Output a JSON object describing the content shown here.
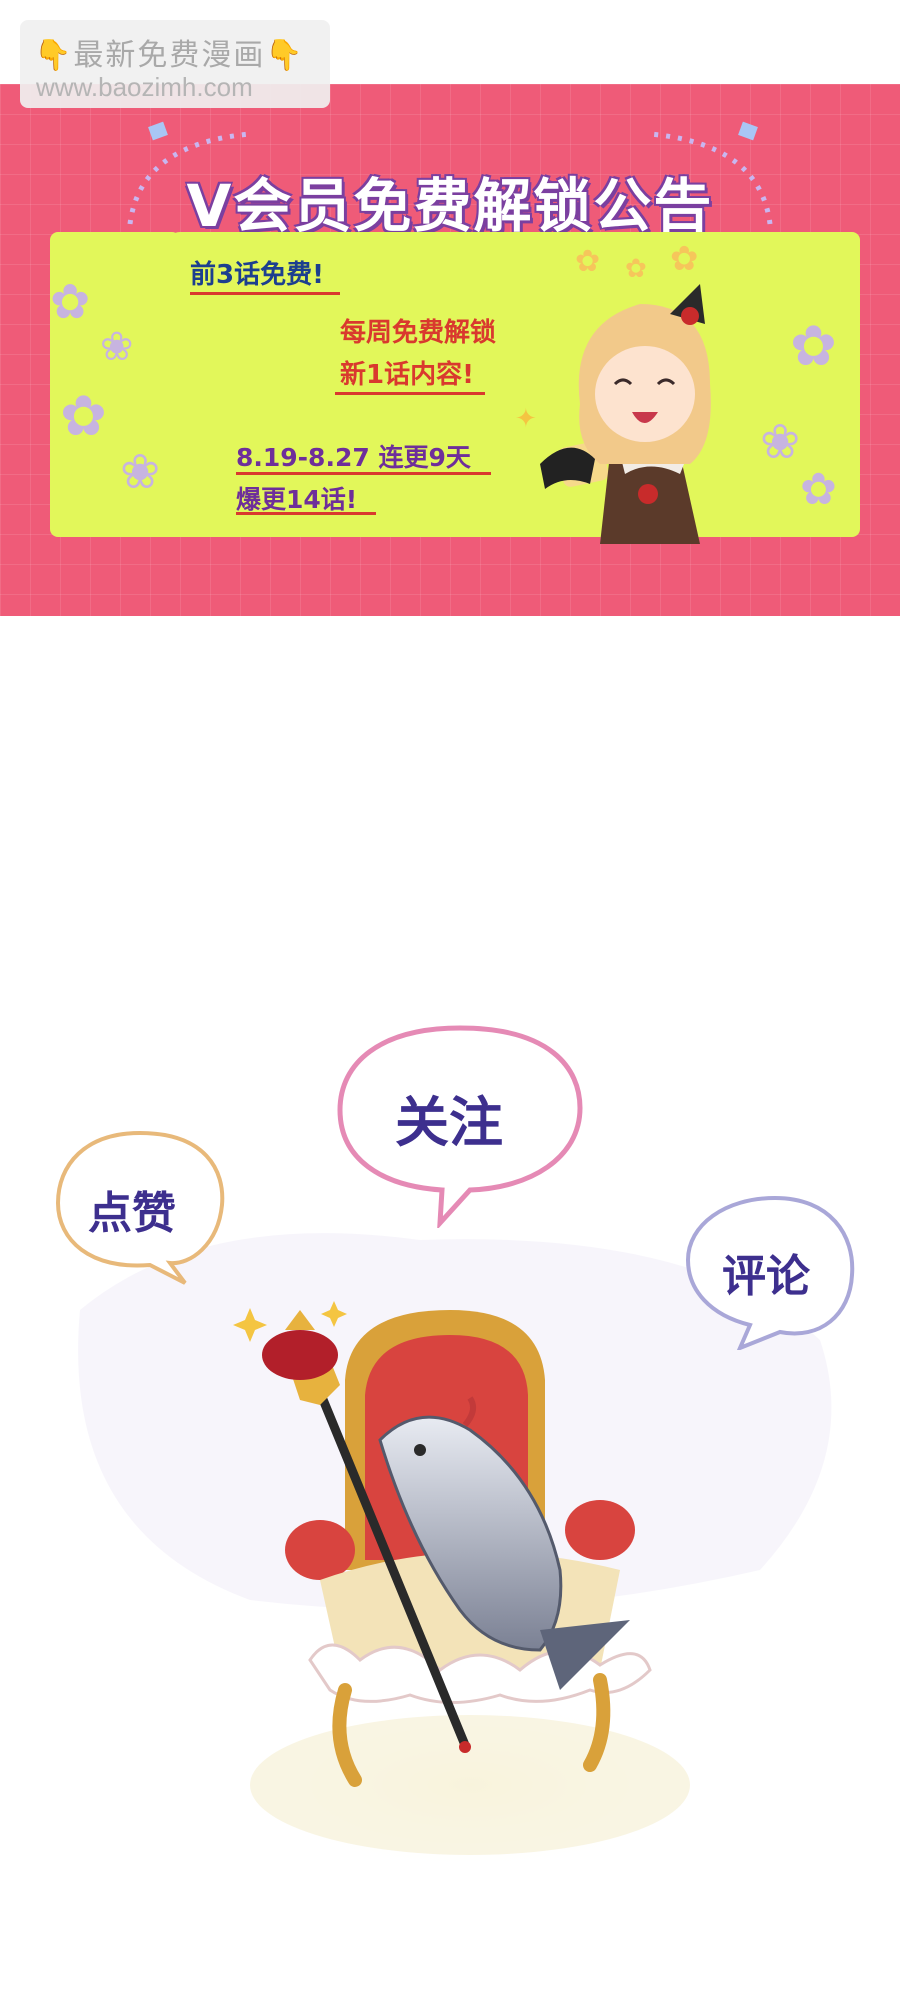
{
  "watermark": {
    "line1": "最新免费漫画",
    "line2": "www.baozimh.com",
    "hand_icon": "👇"
  },
  "banner": {
    "title": "V会员免费解锁公告",
    "free_first": "前3话免费!",
    "weekly_line1": "每周免费解锁",
    "weekly_line2": "新1话内容!",
    "dates": "8.19-8.27 连更9天",
    "burst": "爆更14话!"
  },
  "bubbles": {
    "like": "点赞",
    "follow": "关注",
    "comment": "评论"
  },
  "colors": {
    "banner_bg": "#ef5b78",
    "panel": "#e2f75a",
    "follow_border": "#e58ab5",
    "like_border": "#e8b97a",
    "comment_border": "#a9a7d8",
    "bubble_text": "#3d2f8e"
  }
}
